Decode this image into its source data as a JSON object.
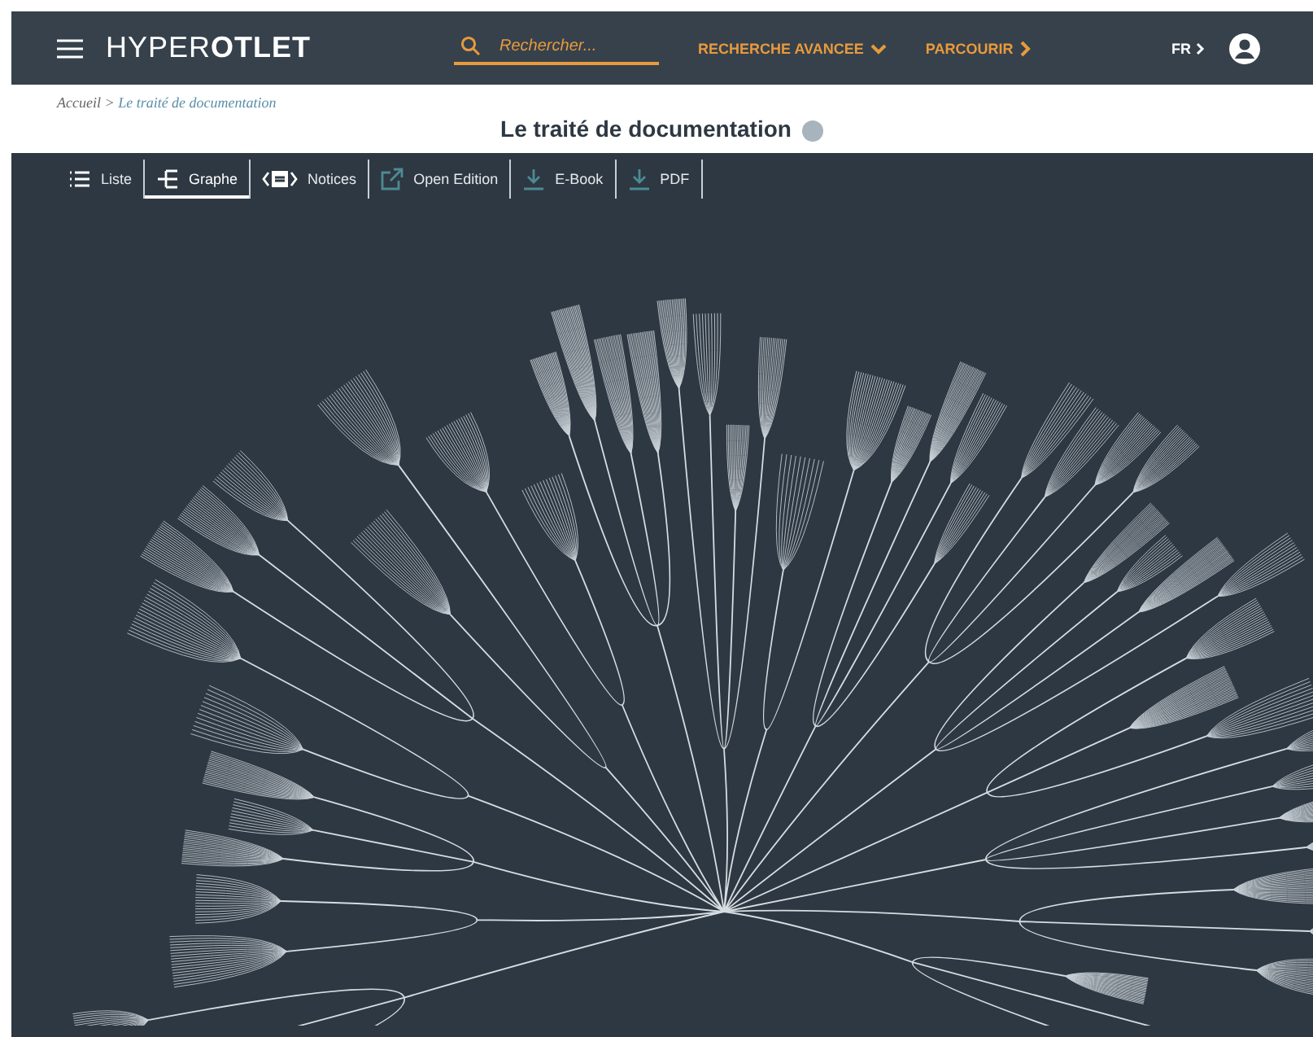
{
  "header": {
    "logo": "HYPER**OTLET**",
    "search": {
      "placeholder": "Rechercher..."
    },
    "nav": [
      {
        "label": "RECHERCHE AVANCEE",
        "kind": "dropdown"
      },
      {
        "label": "PARCOURIR",
        "kind": "link"
      }
    ],
    "language": "FR"
  },
  "breadcrumb": {
    "home": "Accueil",
    "separator": ">",
    "current": "Le traité de documentation"
  },
  "title": "Le traité de documentation",
  "toolbar": [
    {
      "label": "Liste",
      "kind": "list",
      "selected": false,
      "disabled": false
    },
    {
      "label": "Graphe",
      "kind": "graph",
      "selected": true,
      "disabled": false
    },
    {
      "label": "Notices",
      "kind": "code",
      "selected": false,
      "disabled": false
    },
    {
      "label": "Open Edition",
      "kind": "external",
      "selected": false,
      "disabled": true
    },
    {
      "label": "E-Book",
      "kind": "download",
      "selected": false,
      "disabled": true
    },
    {
      "label": "PDF",
      "kind": "download",
      "selected": false,
      "disabled": true
    }
  ]
}
